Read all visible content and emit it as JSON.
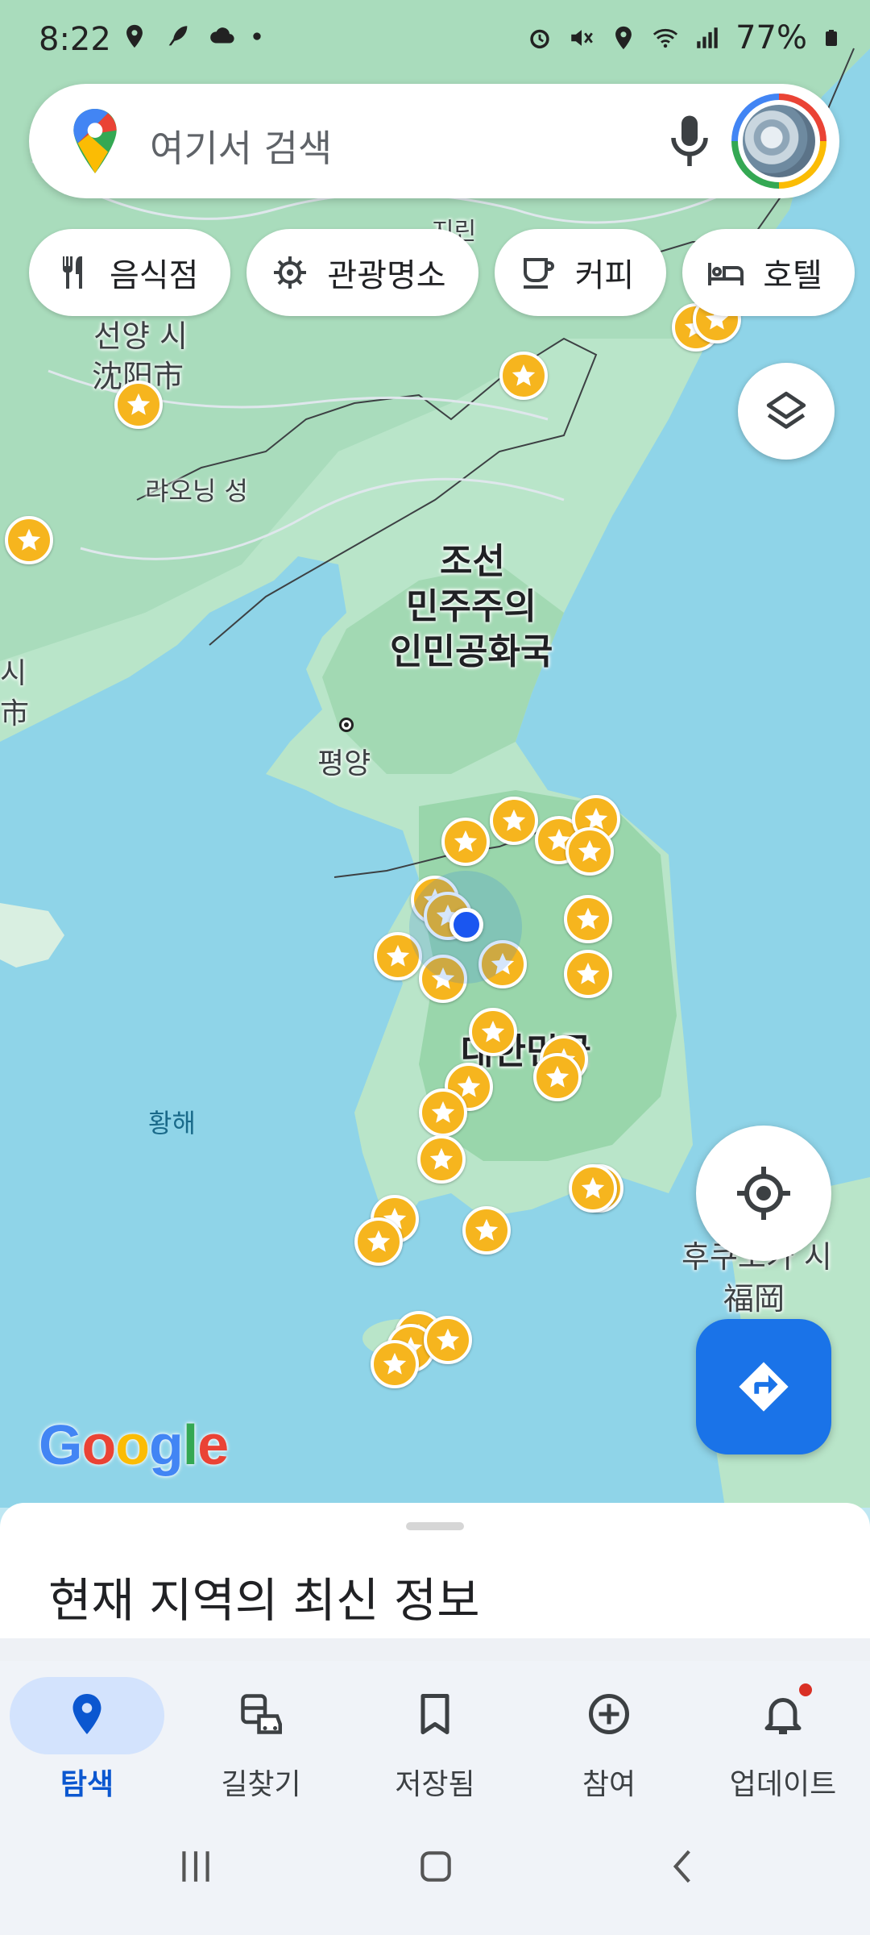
{
  "status_bar": {
    "time": "8:22",
    "battery": "77%",
    "left_icons": [
      "location-icon",
      "feather-icon",
      "cloud-sync-icon",
      "dot-icon"
    ],
    "right_icons": [
      "alarm-icon",
      "mute-icon",
      "location-icon",
      "wifi-icon",
      "signal-icon",
      "battery-icon"
    ]
  },
  "search": {
    "placeholder": "여기서 검색"
  },
  "chips": [
    {
      "label": "음식점",
      "icon": "restaurant-icon"
    },
    {
      "label": "관광명소",
      "icon": "attraction-icon"
    },
    {
      "label": "커피",
      "icon": "coffee-icon"
    },
    {
      "label": "호텔",
      "icon": "hotel-icon"
    }
  ],
  "map": {
    "labels": {
      "shenyang_ko": "선양 시",
      "shenyang_cn": "沈阳市",
      "liaoning": "랴오닝 성",
      "nk_line1": "조선",
      "nk_line2": "민주주의",
      "nk_line3": "인민공화국",
      "pyongyang": "평양",
      "yellow_sea": "황해",
      "south_korea": "대한민국",
      "fukuoka_ko": "후쿠오카 시",
      "fukuoka_cn": "福岡",
      "left_edge_1": "시",
      "left_edge_2": "市",
      "jilin_partial": "지린"
    },
    "colors": {
      "water": "#8fd4e8",
      "land": "#b9e5c9",
      "star_pin": "#f6b51e",
      "location_dot": "#1a56f0"
    }
  },
  "brand": {
    "logo_text": "Google"
  },
  "bottom_sheet": {
    "title": "현재 지역의 최신 정보"
  },
  "nav": [
    {
      "label": "탐색",
      "icon": "explore-pin-icon",
      "active": true
    },
    {
      "label": "길찾기",
      "icon": "commute-icon",
      "active": false
    },
    {
      "label": "저장됨",
      "icon": "bookmark-icon",
      "active": false
    },
    {
      "label": "참여",
      "icon": "add-circle-icon",
      "active": false
    },
    {
      "label": "업데이트",
      "icon": "bell-icon",
      "active": false
    }
  ]
}
